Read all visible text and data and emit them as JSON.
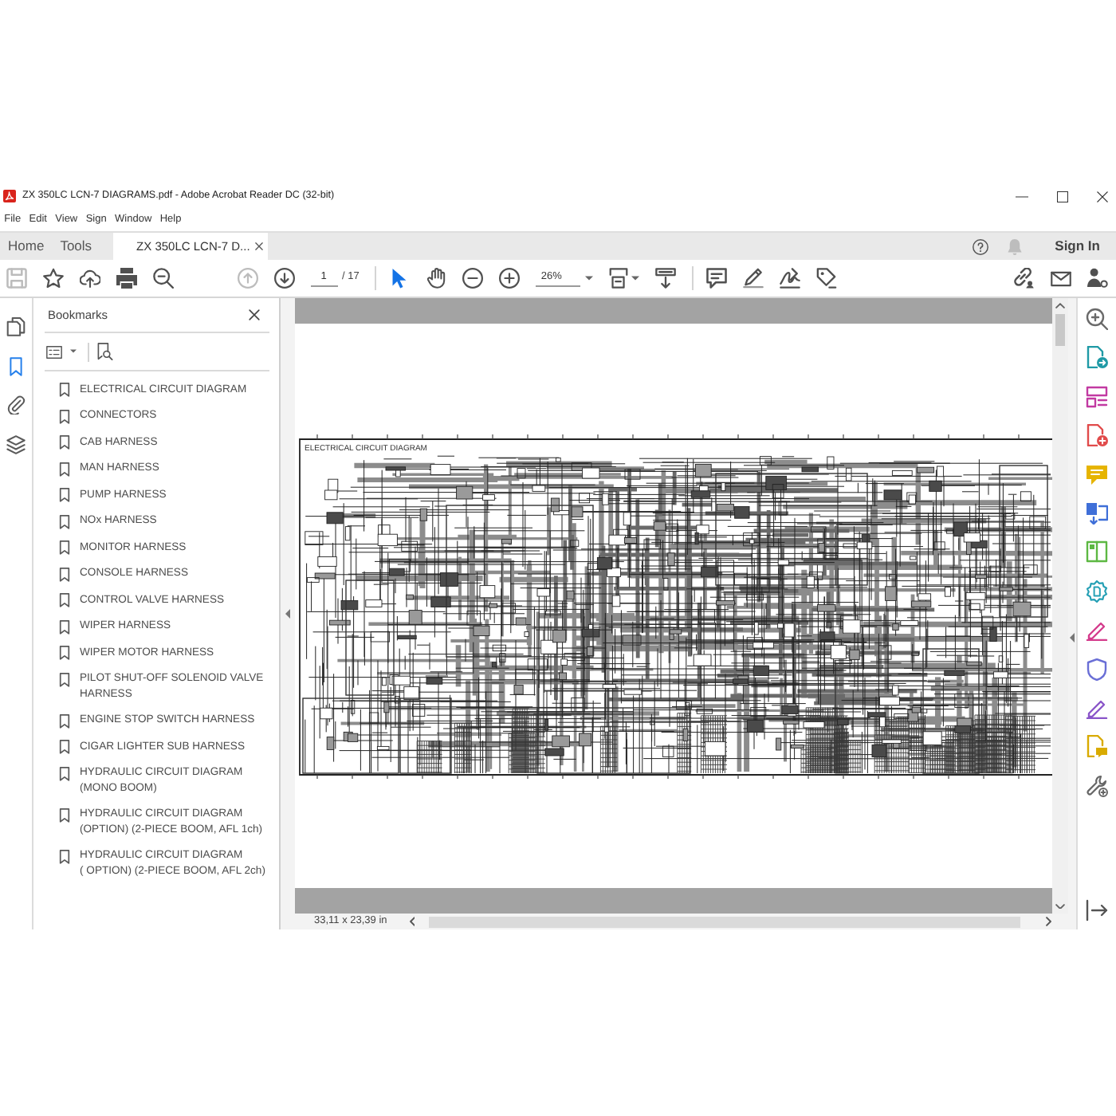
{
  "window": {
    "title": "ZX 350LC LCN-7 DIAGRAMS.pdf - Adobe Acrobat Reader DC (32-bit)"
  },
  "menu": [
    "File",
    "Edit",
    "View",
    "Sign",
    "Window",
    "Help"
  ],
  "tabs": [
    {
      "label": "Home",
      "kind": "nav",
      "selected": false
    },
    {
      "label": "Tools",
      "kind": "nav",
      "selected": false
    },
    {
      "label": "ZX 350LC LCN-7 D...",
      "kind": "document",
      "selected": true
    }
  ],
  "account": {
    "sign_in": "Sign In"
  },
  "toolbar": {
    "actions": [
      {
        "kind": "save",
        "disabled": true
      },
      {
        "kind": "star",
        "disabled": false
      },
      {
        "kind": "upload",
        "disabled": false
      },
      {
        "kind": "print",
        "disabled": false
      },
      {
        "kind": "search",
        "disabled": false
      }
    ],
    "page_nav": [
      {
        "kind": "previous",
        "disabled": true
      },
      {
        "kind": "next",
        "disabled": false
      }
    ],
    "page_number": "1",
    "page_count": "/ 17",
    "pointer_tools": [
      {
        "kind": "select",
        "selected": true
      },
      {
        "kind": "hand",
        "selected": false
      }
    ],
    "zoom": "26%"
  },
  "side_nav": [
    {
      "kind": "pages",
      "selected": false
    },
    {
      "kind": "bookmarks",
      "selected": true
    },
    {
      "kind": "attachments",
      "selected": false
    },
    {
      "kind": "layers",
      "selected": false
    }
  ],
  "bookmarks_panel": {
    "title": "Bookmarks",
    "items": [
      "ELECTRICAL CIRCUIT DIAGRAM",
      "CONNECTORS",
      "CAB HARNESS",
      "MAN HARNESS",
      "PUMP HARNESS",
      "NOx HARNESS",
      "MONITOR HARNESS",
      "CONSOLE HARNESS",
      "CONTROL VALVE HARNESS",
      "WIPER HARNESS",
      "WIPER MOTOR HARNESS",
      "PILOT SHUT-OFF SOLENOID VALVE HARNESS",
      "ENGINE STOP SWITCH HARNESS",
      "CIGAR LIGHTER SUB HARNESS",
      "HYDRAULIC CIRCUIT DIAGRAM (MONO BOOM)",
      "HYDRAULIC CIRCUIT DIAGRAM (OPTION) (2-PIECE BOOM, AFL 1ch)",
      "HYDRAULIC CIRCUIT DIAGRAM ( OPTION) (2-PIECE BOOM, AFL 2ch)"
    ]
  },
  "document": {
    "diagram_title": "ELECTRICAL CIRCUIT DIAGRAM",
    "page_size": "33,11 x 23,39 in"
  }
}
